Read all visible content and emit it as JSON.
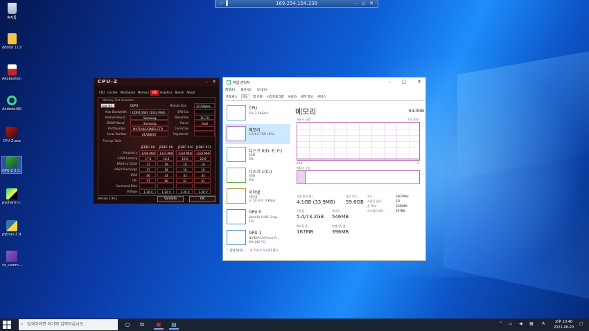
{
  "remote_bar": {
    "ip": "169.254.154.238"
  },
  "desktop_icons": [
    {
      "label": "휴지통"
    },
    {
      "label": "ddddd 11.0..."
    },
    {
      "label": "Adobeshon..."
    },
    {
      "label": "Android세트..."
    },
    {
      "label": "CPU-Z.exe"
    },
    {
      "label": "GPU-Z 2.0..."
    },
    {
      "label": "pycharm-c..."
    },
    {
      "label": "python-3.9..."
    },
    {
      "label": "vs_comm..."
    }
  ],
  "cpuz": {
    "title": "CPU-Z",
    "tabs": [
      "CPU",
      "Caches",
      "Mainboard",
      "Memory",
      "SPD",
      "Graphics",
      "Bench",
      "About"
    ],
    "active_tab": "SPD",
    "section1": "Memory Slot Selection",
    "slot": "Slot #1",
    "type": "DDR4",
    "module_size_label": "Module Size",
    "module_size": "32 GBytes",
    "max_bw_label": "Max Bandwidth",
    "max_bw": "DDR4-2667 (1333 MHz)",
    "spd_ext_label": "SPD Ext.",
    "manuf_label": "Module Manuf.",
    "manuf": "Samsung",
    "week_label": "Week/Year",
    "week": "15 / 21",
    "dram_label": "DRAM Manuf.",
    "dram": "Samsung",
    "ranks_label": "Ranks",
    "ranks": "Dual",
    "part_label": "Part Number",
    "part": "M471A4G43MB1-CTD",
    "correction_label": "Correction",
    "serial_label": "Serial Number",
    "serial": "01A6BE07",
    "registered_label": "Registered",
    "section2": "Timings Table",
    "timing_cols": [
      "JEDEC #8",
      "JEDEC #9",
      "JEDEC #10",
      "JEDEC #11"
    ],
    "timing_rows": [
      {
        "label": "Frequency",
        "vals": [
          "1266 MHz",
          "1333 MHz",
          "1333 MHz",
          "1333 MHz"
        ]
      },
      {
        "label": "CAS# Latency",
        "vals": [
          "17.0",
          "18.0",
          "19.0",
          "20.0"
        ]
      },
      {
        "label": "RAS# to CAS#",
        "vals": [
          "17",
          "19",
          "19",
          "19"
        ]
      },
      {
        "label": "RAS# Precharge",
        "vals": [
          "17",
          "19",
          "19",
          "19"
        ]
      },
      {
        "label": "tRAS",
        "vals": [
          "40",
          "43",
          "43",
          "43"
        ]
      },
      {
        "label": "tRC",
        "vals": [
          "57",
          "60",
          "61",
          "61"
        ]
      },
      {
        "label": "Command Rate",
        "vals": [
          "",
          "",
          "",
          ""
        ]
      },
      {
        "label": "Voltage",
        "vals": [
          "1.20 V",
          "1.20 V",
          "1.20 V",
          "1.20 V"
        ]
      }
    ],
    "version": "Version 1.96.1",
    "validate": "Validate",
    "ok": "OK"
  },
  "taskmgr": {
    "title": "작업 관리자",
    "menu": [
      "파일(F)",
      "옵션(O)",
      "보기(V)"
    ],
    "tabs": [
      "프로세스",
      "성능",
      "앱 기록",
      "시작프로그램",
      "사용자",
      "세부 정보",
      "서비스"
    ],
    "active_tab": "성능",
    "items": [
      {
        "name": "CPU",
        "l1": "5% 3.56GHz",
        "l2": ""
      },
      {
        "name": "메모리",
        "l1": "4.1/63.7GB (6%)",
        "l2": ""
      },
      {
        "name": "디스크 0(D: E: F:)",
        "l1": "SSD",
        "l2": "0%"
      },
      {
        "name": "디스크 1(C:)",
        "l1": "SSD",
        "l2": "0%"
      },
      {
        "name": "이더넷",
        "l1": "이더넷",
        "l2": "S: 24.0 R: 0 Kbps"
      },
      {
        "name": "GPU 0",
        "l1": "Intel(R) UHD Grap...",
        "l2": "1%"
      },
      {
        "name": "GPU 1",
        "l1": "NVIDIA GeForce R...",
        "l2": "0% (42 °C)"
      }
    ],
    "main": {
      "title": "메모리",
      "capacity": "64.0GB",
      "usage_label": "메모리 사용",
      "usage_max": "63.7GB",
      "axis_left": "60초",
      "axis_right": "0",
      "comp_label": "메모리 구성",
      "in_use_label": "사용 중(압축)",
      "in_use": "4.1GB (33.9MB)",
      "avail_label": "사용 가능",
      "avail": "59.6GB",
      "committed_label": "커밋됨",
      "committed": "5.4/73.2GB",
      "cached_label": "캐시됨",
      "cached": "546MB",
      "paged_label": "페이징 풀",
      "paged": "167MB",
      "nonpaged_label": "비페이징 풀",
      "nonpaged": "396MB",
      "speed_label": "속도:",
      "speed": "2667MHz",
      "slots_label": "사용된 슬롯:",
      "slots": "2/2",
      "form_label": "폼 팩터:",
      "form": "SODIMM",
      "reserved_label": "하드웨어 예약:",
      "reserved": "297MB"
    },
    "less_detail": "간단히(D)",
    "open_monitor": "리소스 모니터 열기"
  },
  "taskbar": {
    "search_placeholder": "검색하려면 여기에 입력하십시오.",
    "lang": "A",
    "time": "오후 10:40",
    "date": "2021-08-20"
  }
}
